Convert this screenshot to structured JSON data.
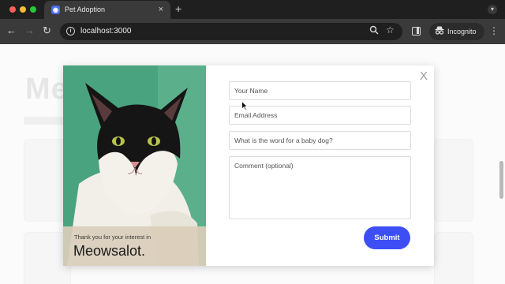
{
  "browser": {
    "tab_title": "Pet Adoption",
    "tab_close": "×",
    "new_tab": "+",
    "url": "localhost:3000",
    "incognito_label": "Incognito",
    "back": "←",
    "forward": "→",
    "reload": "↻",
    "menu": "⋮"
  },
  "modal": {
    "close_label": "X",
    "caption_line1": "Thank you for your interest in",
    "caption_line2": "Meowsalot.",
    "fields": {
      "name_placeholder": "Your Name",
      "email_placeholder": "Email Address",
      "question_placeholder": "What is the word for a baby dog?",
      "comment_placeholder": "Comment (optional)"
    },
    "submit_label": "Submit"
  },
  "colors": {
    "accent": "#3e4ef5",
    "photo_background": "#4aa37f"
  }
}
